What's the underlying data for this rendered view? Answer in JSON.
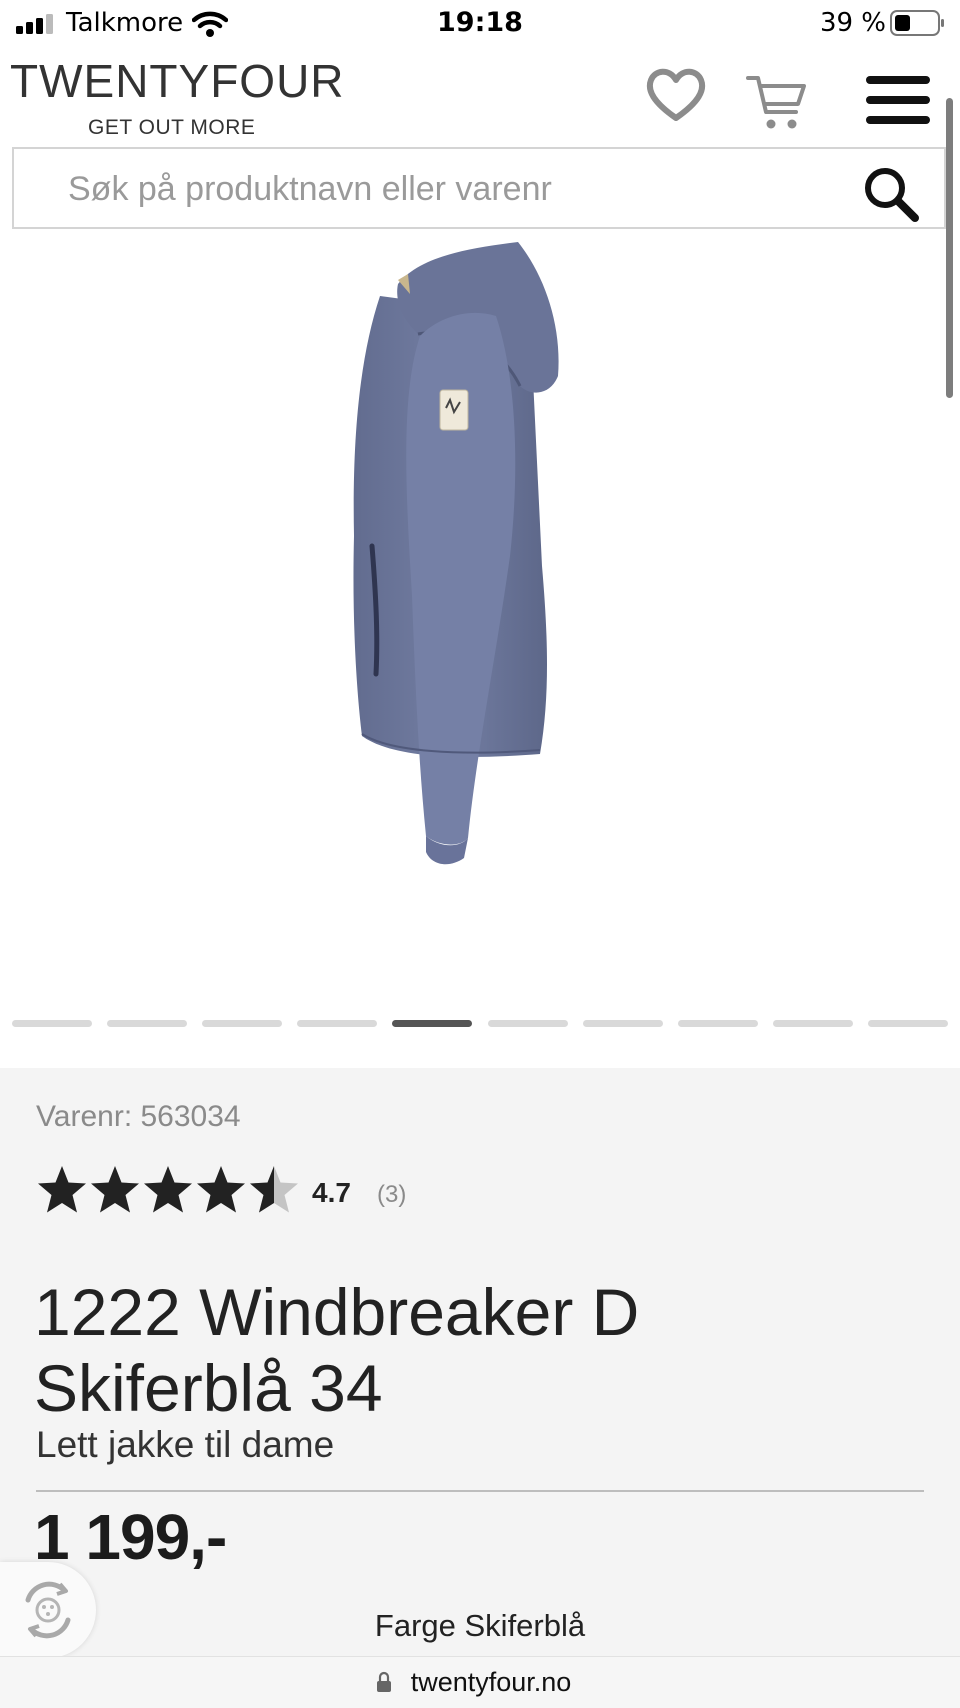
{
  "status_bar": {
    "carrier": "Talkmore",
    "time": "19:18",
    "battery": "39 %"
  },
  "header": {
    "logo_text": "TWENTYFOUR",
    "tagline": "GET OUT MORE",
    "icons": [
      "heart-icon",
      "cart-icon",
      "menu-icon"
    ]
  },
  "search": {
    "placeholder": "Søk på produktnavn eller varenr"
  },
  "gallery": {
    "image": "jacket-product-photo",
    "slide_count": 10,
    "active_slide": 5
  },
  "product": {
    "sku_label": "Varenr:",
    "sku": "563034",
    "rating": "4.7",
    "rating_value": 4.7,
    "rating_count": "(3)",
    "title": "1222 Windbreaker D Skiferblå 34",
    "subtitle": "Lett jakke til dame",
    "price": "1 199,-",
    "color_label": "Farge",
    "color_value": "Skiferblå"
  },
  "browser": {
    "url": "twentyfour.no"
  },
  "colors": {
    "jacket": "#6b7599",
    "star": "#222222",
    "panel_bg": "#f4f4f4"
  }
}
